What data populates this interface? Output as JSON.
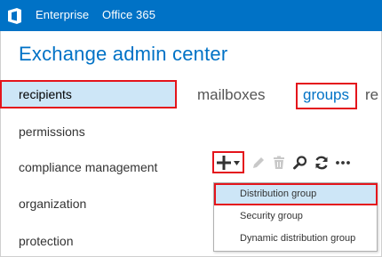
{
  "topbar": {
    "logo_icon": "office-logo-icon",
    "enterprise_label": "Enterprise",
    "office365_label": "Office 365",
    "background_color": "#0072c6"
  },
  "app": {
    "title": "Exchange admin center"
  },
  "sidebar": {
    "items": [
      {
        "label": "recipients",
        "selected": true
      },
      {
        "label": "permissions"
      },
      {
        "label": "compliance management"
      },
      {
        "label": "organization"
      },
      {
        "label": "protection"
      }
    ]
  },
  "tabs": [
    {
      "label": "mailboxes"
    },
    {
      "label": "groups",
      "selected": true
    },
    {
      "label": "re"
    }
  ],
  "toolbar": {
    "icons": [
      "add-icon",
      "edit-icon",
      "delete-icon",
      "search-icon",
      "refresh-icon",
      "more-icon"
    ]
  },
  "new_menu": {
    "items": [
      {
        "label": "Distribution group",
        "highlighted": true
      },
      {
        "label": "Security group"
      },
      {
        "label": "Dynamic distribution group"
      }
    ]
  },
  "colors": {
    "accent": "#0072c6",
    "highlight": "#cde6f7",
    "annotation": "#e4141b"
  }
}
